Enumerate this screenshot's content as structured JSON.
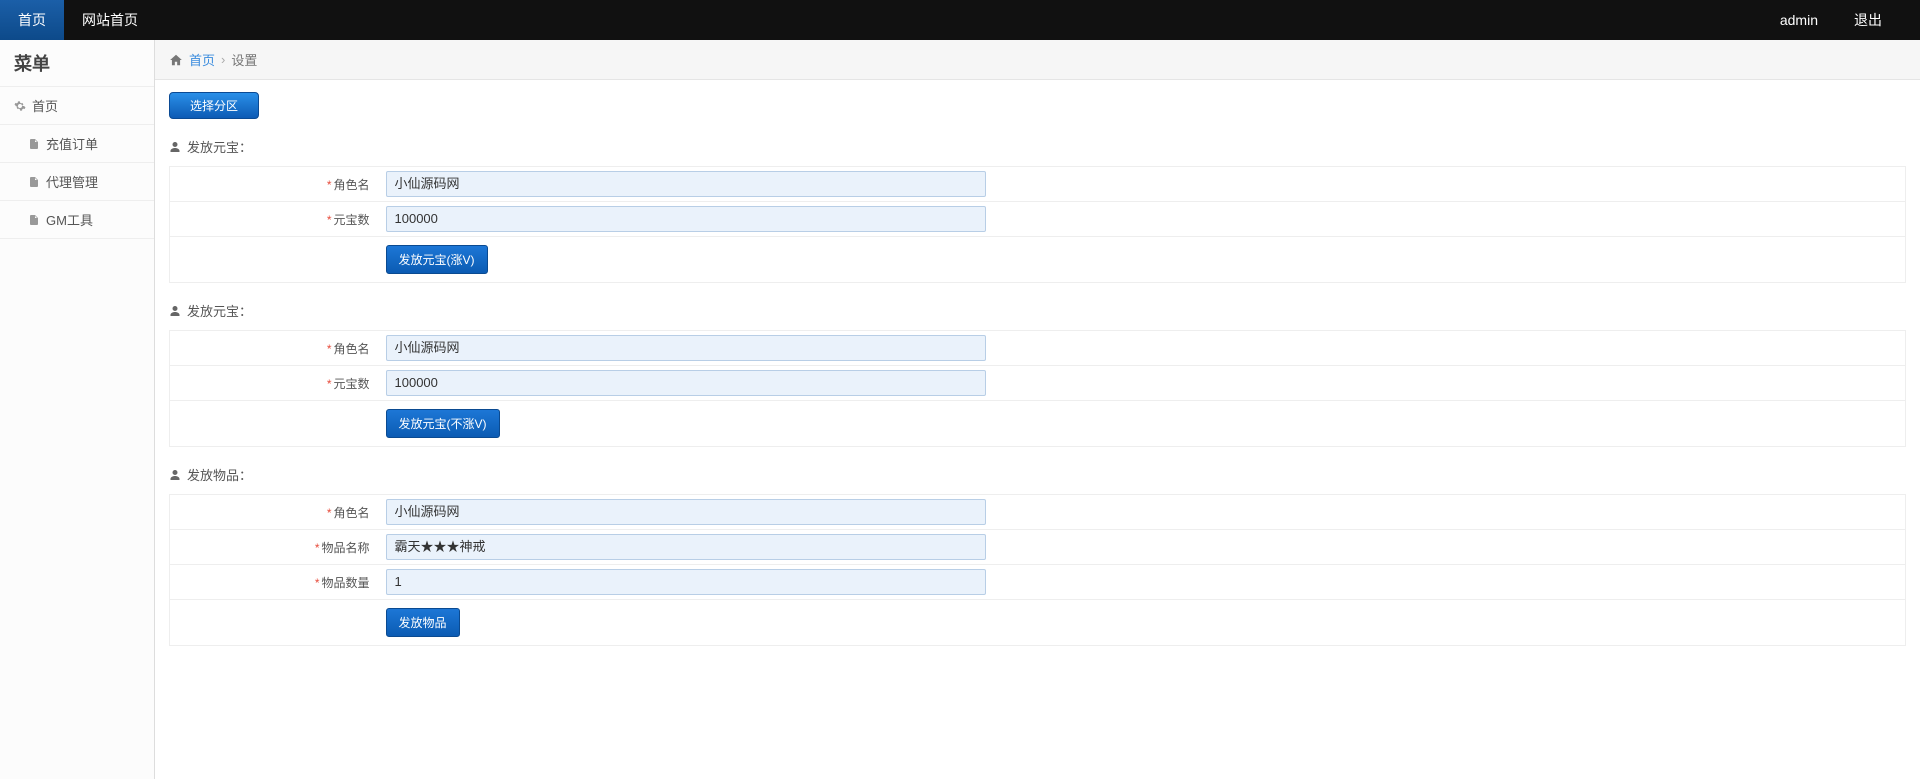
{
  "topbar": {
    "home": "首页",
    "site_home": "网站首页",
    "user": "admin",
    "logout": "退出"
  },
  "sidebar": {
    "title": "菜单",
    "items": [
      {
        "label": "首页",
        "type": "gear"
      },
      {
        "label": "充值订单",
        "type": "file"
      },
      {
        "label": "代理管理",
        "type": "file"
      },
      {
        "label": "GM工具",
        "type": "file"
      }
    ]
  },
  "breadcrumb": {
    "home": "首页",
    "current": "设置"
  },
  "zone_button": "选择分区",
  "sections": [
    {
      "title": "发放元宝：",
      "rows": [
        {
          "label": "角色名",
          "value": "小仙源码网"
        },
        {
          "label": "元宝数",
          "value": "100000"
        }
      ],
      "button": "发放元宝(涨V)"
    },
    {
      "title": "发放元宝：",
      "rows": [
        {
          "label": "角色名",
          "value": "小仙源码网"
        },
        {
          "label": "元宝数",
          "value": "100000"
        }
      ],
      "button": "发放元宝(不涨V)"
    },
    {
      "title": "发放物品：",
      "rows": [
        {
          "label": "角色名",
          "value": "小仙源码网"
        },
        {
          "label": "物品名称",
          "value": "霸天★★★神戒"
        },
        {
          "label": "物品数量",
          "value": "1"
        }
      ],
      "button": "发放物品"
    }
  ]
}
